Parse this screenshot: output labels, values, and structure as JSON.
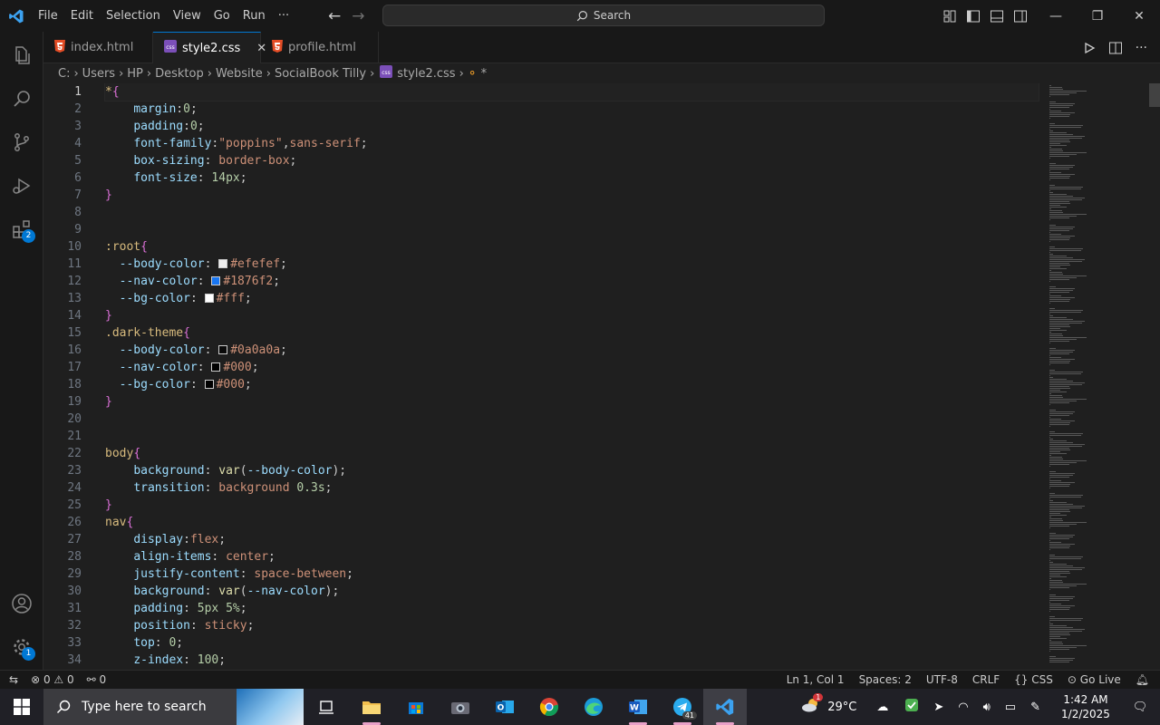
{
  "menu": [
    "File",
    "Edit",
    "Selection",
    "View",
    "Go",
    "Run",
    "···"
  ],
  "search_label": "Search",
  "tabs": [
    {
      "label": "index.html",
      "icon": "html5-icon"
    },
    {
      "label": "style2.css",
      "icon": "css-icon"
    },
    {
      "label": "profile.html",
      "icon": "html5-icon"
    }
  ],
  "breadcrumb": [
    "C:",
    "Users",
    "HP",
    "Desktop",
    "Website",
    "SocialBook Tilly",
    "style2.css",
    "*"
  ],
  "activity": {
    "extensions_badge": "2",
    "settings_badge": "1"
  },
  "code_lines": [
    [
      [
        "t-sel",
        "*"
      ],
      [
        "t-br",
        "{"
      ]
    ],
    [
      [
        "t-pun",
        "    "
      ],
      [
        "t-prop",
        "margin"
      ],
      [
        "t-pun",
        ":"
      ],
      [
        "t-num",
        "0"
      ],
      [
        "t-pun",
        ";"
      ]
    ],
    [
      [
        "t-pun",
        "    "
      ],
      [
        "t-prop",
        "padding"
      ],
      [
        "t-pun",
        ":"
      ],
      [
        "t-num",
        "0"
      ],
      [
        "t-pun",
        ";"
      ]
    ],
    [
      [
        "t-pun",
        "    "
      ],
      [
        "t-prop",
        "font-family"
      ],
      [
        "t-pun",
        ":"
      ],
      [
        "t-str",
        "\"poppins\""
      ],
      [
        "t-pun",
        ","
      ],
      [
        "t-val",
        "sans-serif"
      ],
      [
        "t-pun",
        ";"
      ]
    ],
    [
      [
        "t-pun",
        "    "
      ],
      [
        "t-prop",
        "box-sizing"
      ],
      [
        "t-pun",
        ": "
      ],
      [
        "t-val",
        "border-box"
      ],
      [
        "t-pun",
        ";"
      ]
    ],
    [
      [
        "t-pun",
        "    "
      ],
      [
        "t-prop",
        "font-size"
      ],
      [
        "t-pun",
        ": "
      ],
      [
        "t-num",
        "14"
      ],
      [
        "t-unit",
        "px"
      ],
      [
        "t-pun",
        ";"
      ]
    ],
    [
      [
        "t-br",
        "}"
      ]
    ],
    [],
    [],
    [
      [
        "t-sel",
        ":root"
      ],
      [
        "t-br",
        "{"
      ]
    ],
    [
      [
        "t-pun",
        "  "
      ],
      [
        "t-var",
        "--body-color"
      ],
      [
        "t-pun",
        ": "
      ],
      [
        "swatch",
        "#efefef"
      ],
      [
        "t-val",
        "#efefef"
      ],
      [
        "t-pun",
        ";"
      ]
    ],
    [
      [
        "t-pun",
        "  "
      ],
      [
        "t-var",
        "--nav-color"
      ],
      [
        "t-pun",
        ": "
      ],
      [
        "swatch",
        "#1876f2"
      ],
      [
        "t-val",
        "#1876f2"
      ],
      [
        "t-pun",
        ";"
      ]
    ],
    [
      [
        "t-pun",
        "  "
      ],
      [
        "t-var",
        "--bg-color"
      ],
      [
        "t-pun",
        ": "
      ],
      [
        "swatch",
        "#fff"
      ],
      [
        "t-val",
        "#fff"
      ],
      [
        "t-pun",
        ";"
      ]
    ],
    [
      [
        "t-br",
        "}"
      ]
    ],
    [
      [
        "t-sel",
        ".dark-theme"
      ],
      [
        "t-br",
        "{"
      ]
    ],
    [
      [
        "t-pun",
        "  "
      ],
      [
        "t-var",
        "--body-color"
      ],
      [
        "t-pun",
        ": "
      ],
      [
        "swatch",
        "#0a0a0a"
      ],
      [
        "t-val",
        "#0a0a0a"
      ],
      [
        "t-pun",
        ";"
      ]
    ],
    [
      [
        "t-pun",
        "  "
      ],
      [
        "t-var",
        "--nav-color"
      ],
      [
        "t-pun",
        ": "
      ],
      [
        "swatch",
        "#000"
      ],
      [
        "t-val",
        "#000"
      ],
      [
        "t-pun",
        ";"
      ]
    ],
    [
      [
        "t-pun",
        "  "
      ],
      [
        "t-var",
        "--bg-color"
      ],
      [
        "t-pun",
        ": "
      ],
      [
        "swatch",
        "#000"
      ],
      [
        "t-val",
        "#000"
      ],
      [
        "t-pun",
        ";"
      ]
    ],
    [
      [
        "t-br",
        "}"
      ]
    ],
    [],
    [],
    [
      [
        "t-tag",
        "body"
      ],
      [
        "t-br",
        "{"
      ]
    ],
    [
      [
        "t-pun",
        "    "
      ],
      [
        "t-prop",
        "background"
      ],
      [
        "t-pun",
        ": "
      ],
      [
        "t-fn",
        "var"
      ],
      [
        "t-pun",
        "("
      ],
      [
        "t-var",
        "--body-color"
      ],
      [
        "t-pun",
        ");"
      ]
    ],
    [
      [
        "t-pun",
        "    "
      ],
      [
        "t-prop",
        "transition"
      ],
      [
        "t-pun",
        ": "
      ],
      [
        "t-val",
        "background"
      ],
      [
        "t-pun",
        " "
      ],
      [
        "t-num",
        "0.3"
      ],
      [
        "t-unit",
        "s"
      ],
      [
        "t-pun",
        ";"
      ]
    ],
    [
      [
        "t-br",
        "}"
      ]
    ],
    [
      [
        "t-tag",
        "nav"
      ],
      [
        "t-br",
        "{"
      ]
    ],
    [
      [
        "t-pun",
        "    "
      ],
      [
        "t-prop",
        "display"
      ],
      [
        "t-pun",
        ":"
      ],
      [
        "t-val",
        "flex"
      ],
      [
        "t-pun",
        ";"
      ]
    ],
    [
      [
        "t-pun",
        "    "
      ],
      [
        "t-prop",
        "align-items"
      ],
      [
        "t-pun",
        ": "
      ],
      [
        "t-val",
        "center"
      ],
      [
        "t-pun",
        ";"
      ]
    ],
    [
      [
        "t-pun",
        "    "
      ],
      [
        "t-prop",
        "justify-content"
      ],
      [
        "t-pun",
        ": "
      ],
      [
        "t-val",
        "space-between"
      ],
      [
        "t-pun",
        ";"
      ]
    ],
    [
      [
        "t-pun",
        "    "
      ],
      [
        "t-prop",
        "background"
      ],
      [
        "t-pun",
        ": "
      ],
      [
        "t-fn",
        "var"
      ],
      [
        "t-pun",
        "("
      ],
      [
        "t-var",
        "--nav-color"
      ],
      [
        "t-pun",
        ");"
      ]
    ],
    [
      [
        "t-pun",
        "    "
      ],
      [
        "t-prop",
        "padding"
      ],
      [
        "t-pun",
        ": "
      ],
      [
        "t-num",
        "5"
      ],
      [
        "t-unit",
        "px"
      ],
      [
        "t-pun",
        " "
      ],
      [
        "t-num",
        "5"
      ],
      [
        "t-unit",
        "%"
      ],
      [
        "t-pun",
        ";"
      ]
    ],
    [
      [
        "t-pun",
        "    "
      ],
      [
        "t-prop",
        "position"
      ],
      [
        "t-pun",
        ": "
      ],
      [
        "t-val",
        "sticky"
      ],
      [
        "t-pun",
        ";"
      ]
    ],
    [
      [
        "t-pun",
        "    "
      ],
      [
        "t-prop",
        "top"
      ],
      [
        "t-pun",
        ": "
      ],
      [
        "t-num",
        "0"
      ],
      [
        "t-pun",
        ";"
      ]
    ],
    [
      [
        "t-pun",
        "    "
      ],
      [
        "t-prop",
        "z-index"
      ],
      [
        "t-pun",
        ": "
      ],
      [
        "t-num",
        "100"
      ],
      [
        "t-pun",
        ";"
      ]
    ]
  ],
  "status": {
    "errors": "0",
    "warnings": "0",
    "ports": "0",
    "position": "Ln 1, Col 1",
    "spaces": "Spaces: 2",
    "encoding": "UTF-8",
    "eol": "CRLF",
    "language": "CSS",
    "golive": "Go Live"
  },
  "taskbar": {
    "search_placeholder": "Type here to search",
    "weather": "29°C",
    "time": "1:42 AM",
    "date": "1/2/2025",
    "telegram_badge": "41",
    "weather_badge": "1"
  },
  "colors": {
    "accent": "#0078d4",
    "editor_bg": "#1f1f1f",
    "chrome_bg": "#181818"
  }
}
